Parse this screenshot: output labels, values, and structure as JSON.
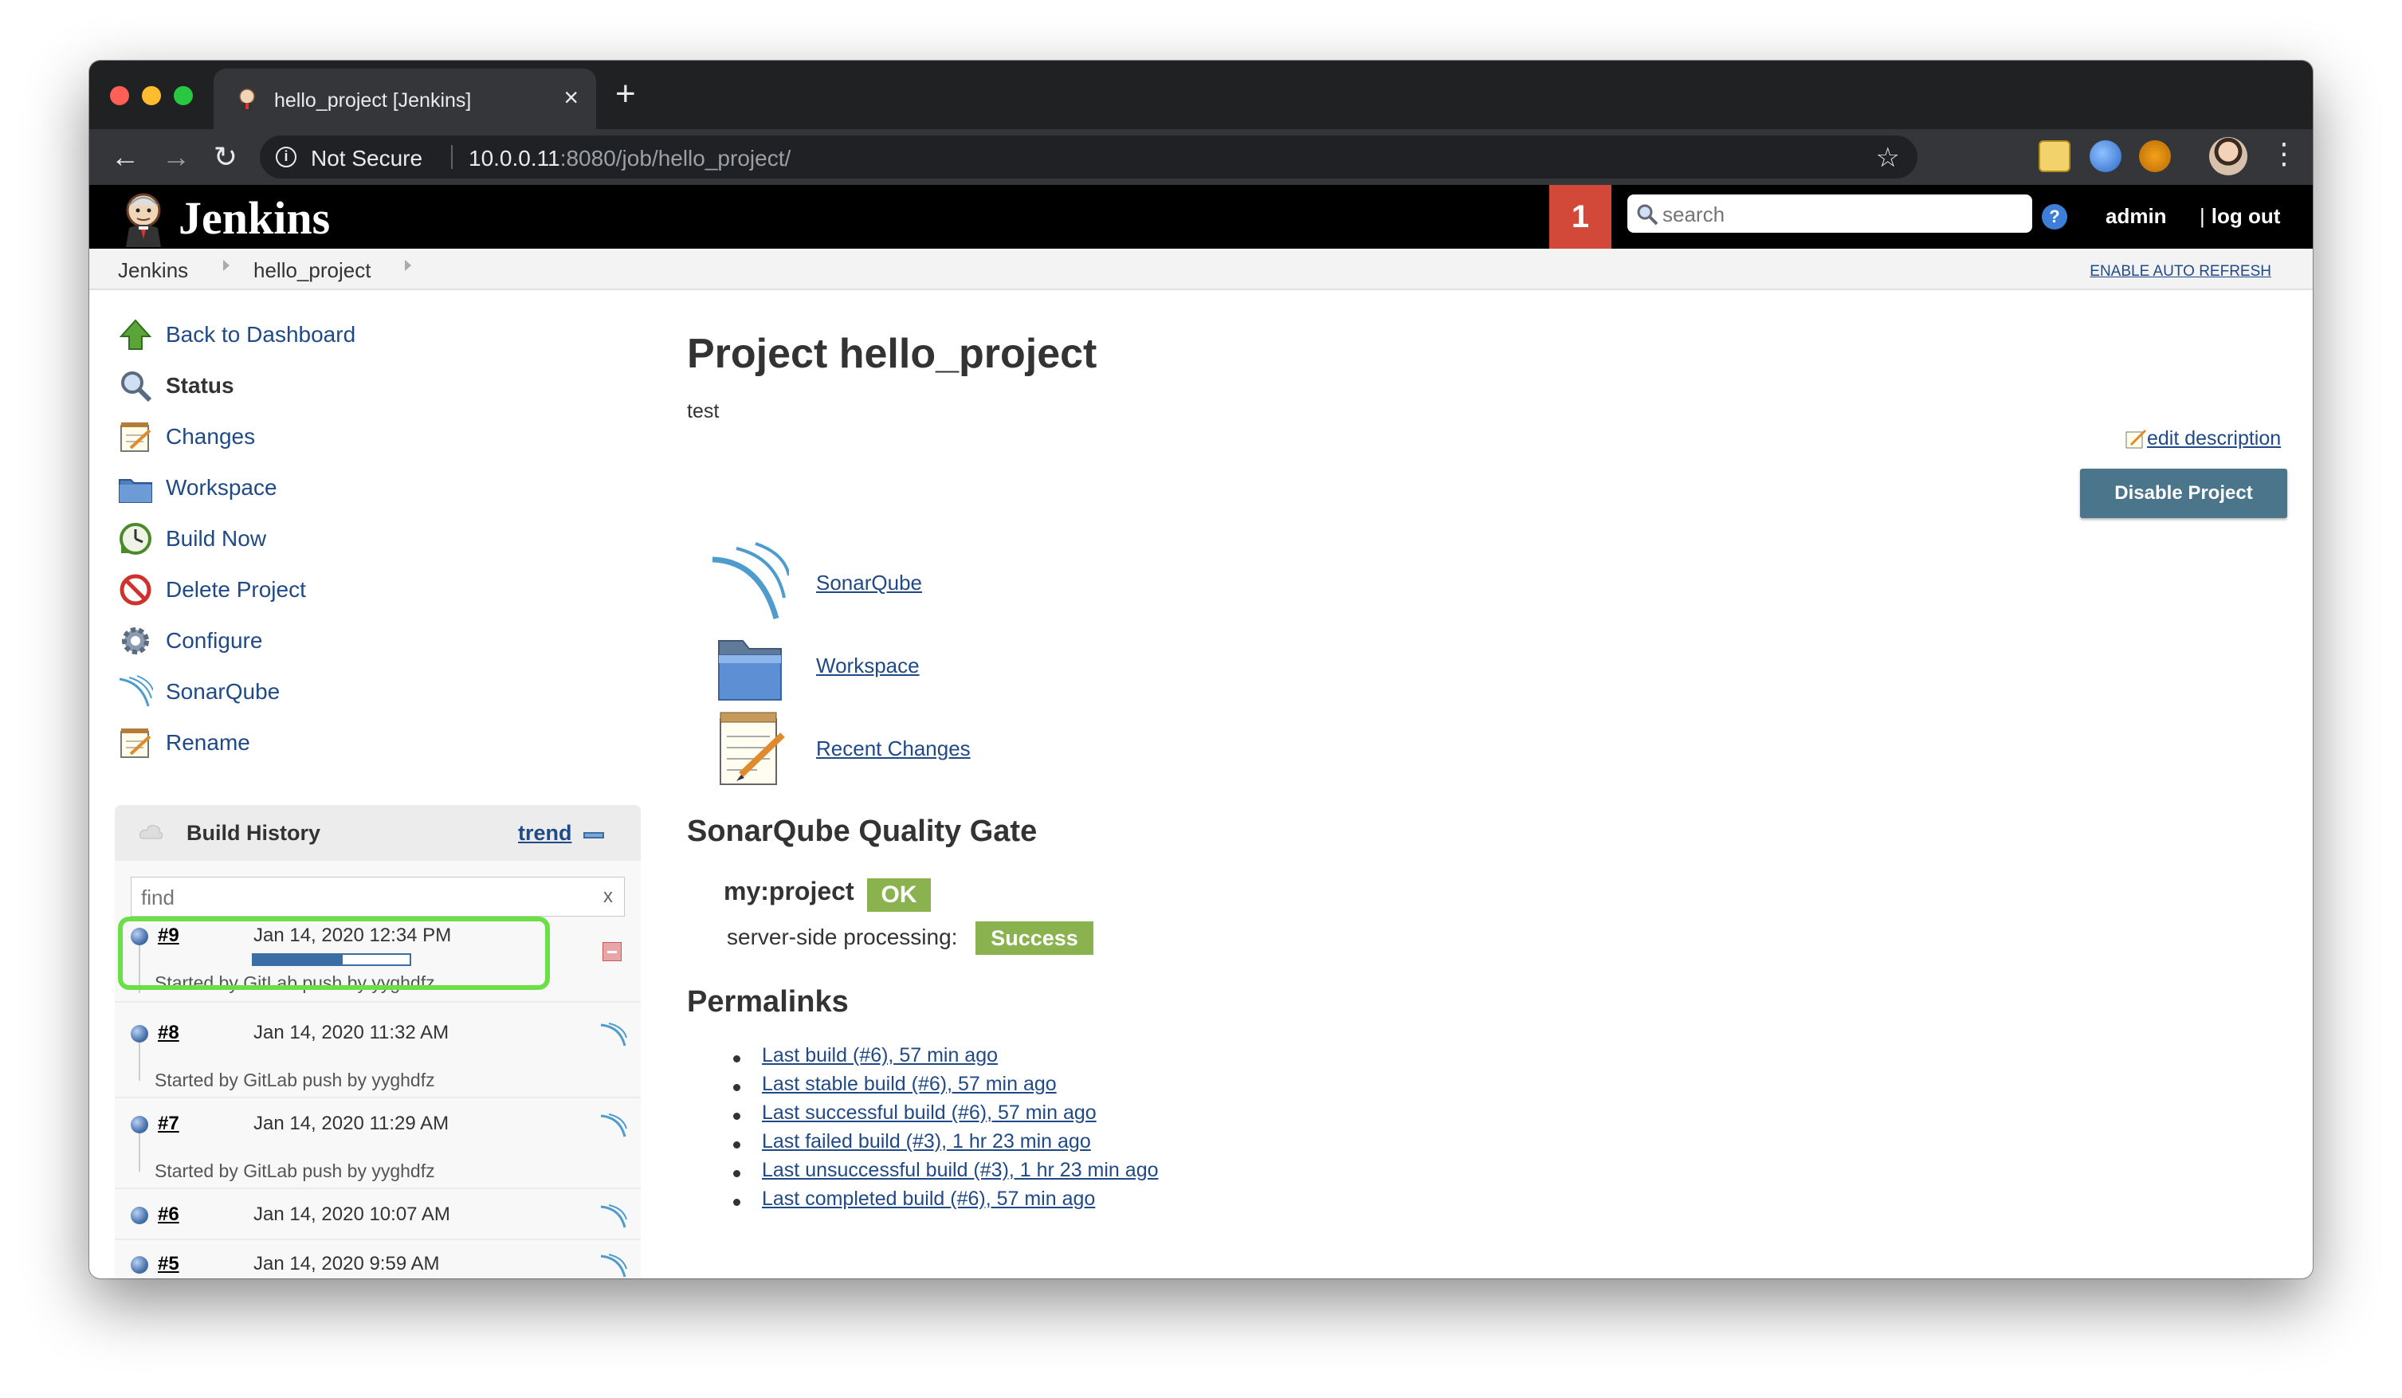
{
  "browser": {
    "tab_title": "hello_project [Jenkins]",
    "tab_close": "×",
    "new_tab": "+",
    "security_label": "Not Secure",
    "url_host": "10.0.0.11",
    "url_rest": ":8080/job/hello_project/"
  },
  "header": {
    "brand": "Jenkins",
    "notification_count": "1",
    "search_placeholder": "search",
    "help": "?",
    "user": "admin",
    "logout": "log out"
  },
  "breadcrumb": {
    "items": [
      "Jenkins",
      "hello_project"
    ],
    "auto_refresh": "ENABLE AUTO REFRESH"
  },
  "sidebar": {
    "tasks": [
      {
        "label": "Back to Dashboard",
        "icon": "up-arrow-icon"
      },
      {
        "label": "Status",
        "icon": "search-icon"
      },
      {
        "label": "Changes",
        "icon": "notepad-icon"
      },
      {
        "label": "Workspace",
        "icon": "folder-icon"
      },
      {
        "label": "Build Now",
        "icon": "clock-icon"
      },
      {
        "label": "Delete Project",
        "icon": "no-entry-icon"
      },
      {
        "label": "Configure",
        "icon": "gear-icon"
      },
      {
        "label": "SonarQube",
        "icon": "sonarqube-icon"
      },
      {
        "label": "Rename",
        "icon": "notepad-icon"
      }
    ]
  },
  "build_history": {
    "title": "Build History",
    "trend": "trend",
    "find_placeholder": "find",
    "find_clear": "x",
    "builds": [
      {
        "number": "#9",
        "date": "Jan 14, 2020 12:34 PM",
        "started_by": "Started by GitLab push by yyghdfz",
        "in_progress": true,
        "progress": 0.57
      },
      {
        "number": "#8",
        "date": "Jan 14, 2020 11:32 AM",
        "started_by": "Started by GitLab push by yyghdfz"
      },
      {
        "number": "#7",
        "date": "Jan 14, 2020 11:29 AM",
        "started_by": "Started by GitLab push by yyghdfz"
      },
      {
        "number": "#6",
        "date": "Jan 14, 2020 10:07 AM"
      },
      {
        "number": "#5",
        "date": "Jan 14, 2020 9:59 AM"
      }
    ]
  },
  "main": {
    "title": "Project hello_project",
    "description": "test",
    "edit_description": "edit description",
    "disable_button": "Disable Project",
    "links": [
      {
        "label": "SonarQube",
        "icon": "sonarqube-icon"
      },
      {
        "label": "Workspace",
        "icon": "folder-icon"
      },
      {
        "label": "Recent Changes",
        "icon": "notepad-icon"
      }
    ],
    "quality_gate": {
      "heading": "SonarQube Quality Gate",
      "project": "my:project",
      "status": "OK",
      "processing_label": "server-side processing:",
      "processing_status": "Success"
    },
    "permalinks": {
      "heading": "Permalinks",
      "items": [
        "Last build (#6), 57 min ago",
        "Last stable build (#6), 57 min ago",
        "Last successful build (#6), 57 min ago",
        "Last failed build (#3), 1 hr 23 min ago",
        "Last unsuccessful build (#3), 1 hr 23 min ago",
        "Last completed build (#6), 57 min ago"
      ]
    }
  },
  "colors": {
    "link": "#204a87",
    "notification": "#d24939",
    "ok_green": "#8ab24e",
    "button_blue": "#4b758b",
    "highlight_green": "#6be046"
  }
}
